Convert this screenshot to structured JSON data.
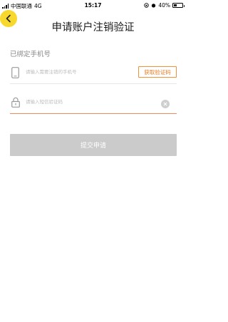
{
  "status_bar": {
    "carrier": "中国联通",
    "network": "4G",
    "time": "15:17",
    "battery": "40%",
    "battery_level": 0.4
  },
  "header": {
    "title": "申请账户注销验证",
    "back_icon": "chevron-left-icon",
    "accent_color": "#f7d92e"
  },
  "form": {
    "section_label": "已绑定手机号",
    "phone": {
      "icon": "phone-icon",
      "placeholder": "请输入需要注销的手机号",
      "value": ""
    },
    "get_code_label": "获取验证码",
    "code": {
      "icon": "lock-icon",
      "placeholder": "请输入短信验证码",
      "value": ""
    },
    "submit_label": "提交申请"
  }
}
